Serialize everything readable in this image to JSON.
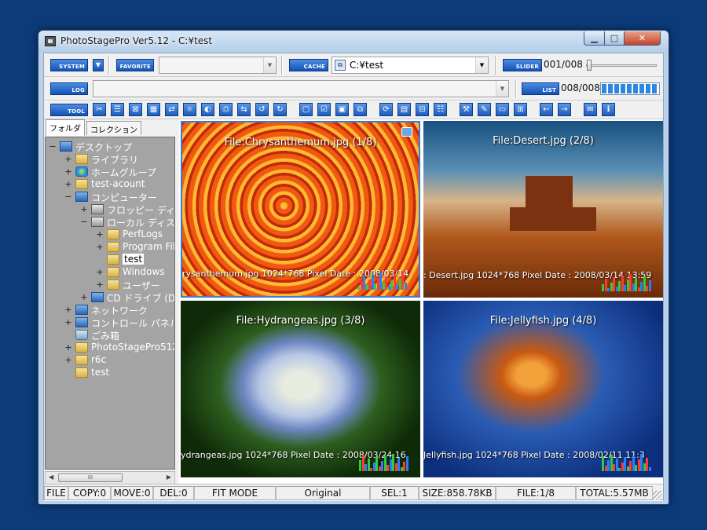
{
  "window": {
    "title": "PhotoStagePro Ver5.12 - C:¥test"
  },
  "toolbar": {
    "system_label": "SYSTEM",
    "favorite_label": "FAVORITE",
    "cache_label": "CACHE",
    "path_value": "C:¥test",
    "slider_label": "SLIDER",
    "slider_count": "001/008",
    "slider_value": 0.01,
    "log_label": "LOG",
    "list_label": "LIST",
    "list_count": "008/008",
    "list_progress": 1.0,
    "tool_label": "TOOL",
    "tool_icons": [
      "scissors-icon",
      "property-icon",
      "crop-icon",
      "grid-icon",
      "sync-icon",
      "brightness-icon",
      "contrast-icon",
      "print-icon",
      "mirror-icon",
      "reload-icon",
      "rotate-icon",
      "frame1-icon",
      "checkbox-icon",
      "frame2-icon",
      "frame3-icon",
      "refresh-icon",
      "calendar-icon",
      "compare-icon",
      "list-view-icon",
      "settings-icon",
      "edit-icon",
      "window-icon",
      "split-icon",
      "back-arrow-icon",
      "forward-arrow-icon",
      "mail-icon",
      "info-icon"
    ]
  },
  "sidebar": {
    "tabs": [
      {
        "label": "フォルダ",
        "active": true
      },
      {
        "label": "コレクション",
        "active": false
      }
    ],
    "tree": [
      {
        "label": "デスクトップ",
        "depth": 0,
        "exp": "−",
        "icon": "blue"
      },
      {
        "label": "ライブラリ",
        "depth": 1,
        "exp": "+",
        "icon": "folder"
      },
      {
        "label": "ホームグループ",
        "depth": 1,
        "exp": "+",
        "icon": "green"
      },
      {
        "label": "test-acount",
        "depth": 1,
        "exp": "+",
        "icon": "folder"
      },
      {
        "label": "コンピューター",
        "depth": 1,
        "exp": "−",
        "icon": "blue"
      },
      {
        "label": "フロッピー ディスク",
        "depth": 2,
        "exp": "+",
        "icon": "gray"
      },
      {
        "label": "ローカル ディスク",
        "depth": 2,
        "exp": "−",
        "icon": "gray"
      },
      {
        "label": "PerfLogs",
        "depth": 3,
        "exp": "+",
        "icon": "folder"
      },
      {
        "label": "Program Files",
        "depth": 3,
        "exp": "+",
        "icon": "folder"
      },
      {
        "label": "test",
        "depth": 3,
        "exp": "",
        "icon": "folder",
        "selected": true
      },
      {
        "label": "Windows",
        "depth": 3,
        "exp": "+",
        "icon": "folder"
      },
      {
        "label": "ユーザー",
        "depth": 3,
        "exp": "+",
        "icon": "folder"
      },
      {
        "label": "CD ドライブ (D:)",
        "depth": 2,
        "exp": "+",
        "icon": "blue"
      },
      {
        "label": "ネットワーク",
        "depth": 1,
        "exp": "+",
        "icon": "blue"
      },
      {
        "label": "コントロール パネル",
        "depth": 1,
        "exp": "+",
        "icon": "blue"
      },
      {
        "label": "ごみ箱",
        "depth": 1,
        "exp": "",
        "icon": "trash"
      },
      {
        "label": "PhotoStagePro512",
        "depth": 1,
        "exp": "+",
        "icon": "folder"
      },
      {
        "label": "r6c",
        "depth": 1,
        "exp": "+",
        "icon": "folder"
      },
      {
        "label": "test",
        "depth": 1,
        "exp": "",
        "icon": "folder"
      }
    ],
    "scroll_thumb": "III"
  },
  "viewer": {
    "tiles": [
      {
        "name": "File:Chrysanthemum.jpg  (1/8)",
        "info": "rysanthemum.jpg  1024*768 Pixel  Date : 2008/03/14"
      },
      {
        "name": "File:Desert.jpg  (2/8)",
        "info": ": Desert.jpg  1024*768 Pixel  Date : 2008/03/14 13:59"
      },
      {
        "name": "File:Hydrangeas.jpg  (3/8)",
        "info": "ydrangeas.jpg  1024*768 Pixel  Date : 2008/03/24 16"
      },
      {
        "name": "File:Jellyfish.jpg  (4/8)",
        "info": "Jellyfish.jpg  1024*768 Pixel  Date : 2008/02/11 11:3"
      }
    ]
  },
  "status": {
    "file": "FILE",
    "copy": "COPY:0",
    "move": "MOVE:0",
    "del": "DEL:0",
    "mode": "FIT MODE",
    "size_mode": "Original",
    "sel": "SEL:1",
    "size": "SIZE:858.78KB",
    "file_pos": "FILE:1/8",
    "total": "TOTAL:5.57MB"
  },
  "colors": {
    "accent": "#1452b8",
    "desktop": "#0c3b7a",
    "tree_bg": "#a4a4a4"
  }
}
